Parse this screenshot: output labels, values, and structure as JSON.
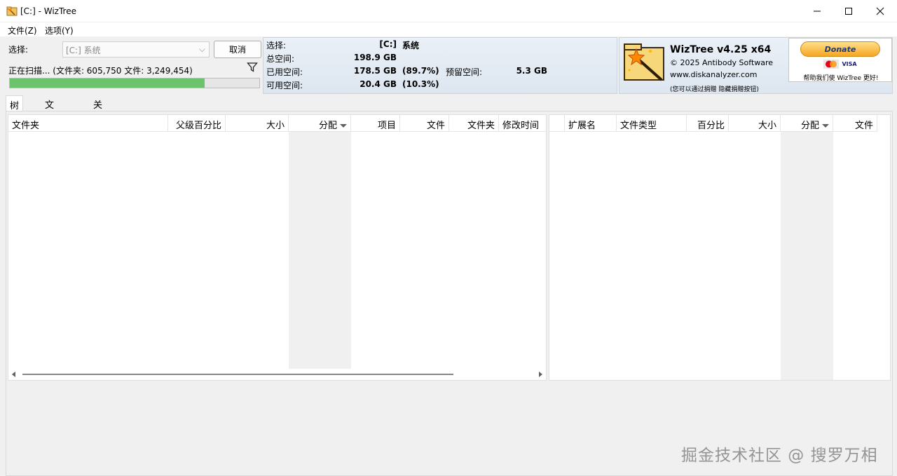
{
  "window": {
    "title": "[C:]  - WizTree",
    "icon": "wiztree-app-icon",
    "controls": [
      "minimize-icon",
      "maximize-icon",
      "close-icon"
    ]
  },
  "menu": {
    "file": "文件(Z)",
    "options": "选项(Y)"
  },
  "scan_panel": {
    "select_label": "选择:",
    "drive_value": "[C:] 系统",
    "cancel_button": "取消",
    "status_text": "正在扫描... (文件夹: 605,750  文件: 3,249,454)",
    "progress_percent": 78,
    "filter_icon": "filter-icon"
  },
  "drive_info": {
    "select_label": "选择:",
    "drive": "[C:]",
    "drive_name": "系统",
    "total_label": "总空间:",
    "total_value": "198.9 GB",
    "used_label": "已用空间:",
    "used_value": "178.5 GB",
    "used_pct": "(89.7%)",
    "reserved_label": "预留空间:",
    "reserved_value": "5.3 GB",
    "free_label": "可用空间:",
    "free_value": "20.4 GB",
    "free_pct": "(10.3%)"
  },
  "brand": {
    "product": "WizTree v4.25 x64",
    "copyright": "© 2025 Antibody Software",
    "website": "www.diskanalyzer.com",
    "note": "(您可以通过捐赠 隐藏捐赠按钮)",
    "donate_label": "Donate",
    "card1": "MC",
    "card2": "VISA",
    "donate_text": "帮助我们使 WizTree 更好!"
  },
  "tabs": [
    "树查看",
    "文件查看",
    "关于"
  ],
  "tree_columns": [
    "文件夹",
    "父级百分比",
    "大小",
    "分配",
    "项目",
    "文件",
    "文件夹",
    "修改时间"
  ],
  "ext_columns": [
    "扩展名",
    "文件类型",
    "百分比",
    "大小",
    "分配",
    "文件"
  ],
  "watermark": "掘金技术社区 @ 搜罗万相"
}
